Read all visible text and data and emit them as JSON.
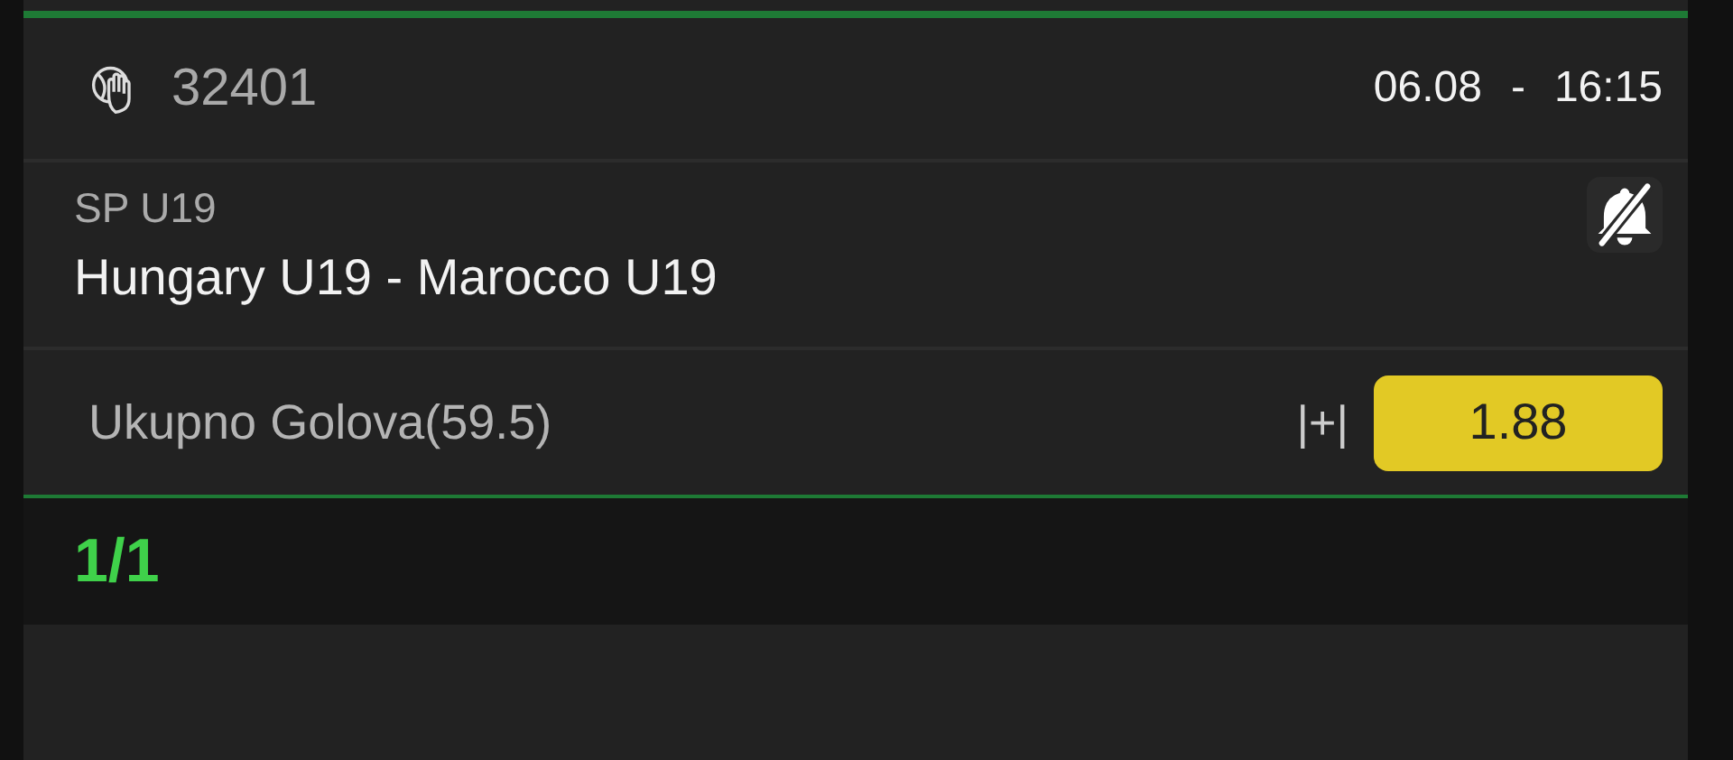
{
  "event": {
    "code": "32401",
    "date": "06.08",
    "separator": "-",
    "time": "16:15",
    "league": "SP U19",
    "match": "Hungary U19 - Marocco U19"
  },
  "market": {
    "name": "Ukupno Golova(59.5)",
    "extra": "|+|",
    "odds": "1.88"
  },
  "pager": "1/1"
}
